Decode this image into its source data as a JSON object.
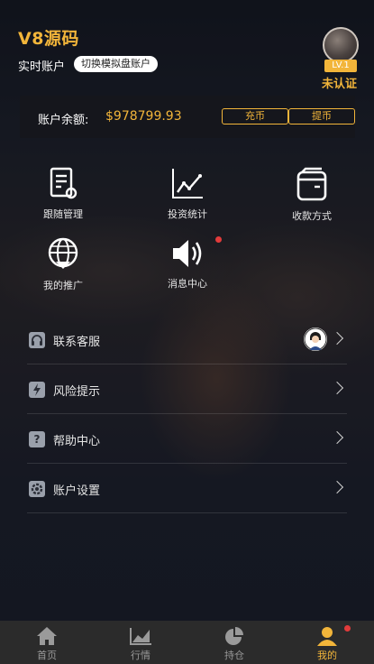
{
  "header": {
    "brand": "V8源码",
    "account_type": "实时账户",
    "switch_label": "切换模拟盘账户",
    "level": "LV.1",
    "verify_status": "未认证"
  },
  "balance": {
    "label": "账户余额:",
    "value": "$978799.93",
    "deposit_label": "充币",
    "withdraw_label": "提币"
  },
  "grid": [
    {
      "label": "跟随管理",
      "icon": "follow-manage-icon"
    },
    {
      "label": "投资统计",
      "icon": "invest-stats-icon"
    },
    {
      "label": "收款方式",
      "icon": "wallet-icon"
    },
    {
      "label": "我的推广",
      "icon": "globe-promo-icon"
    },
    {
      "label": "消息中心",
      "icon": "speaker-icon"
    }
  ],
  "list": [
    {
      "label": "联系客服",
      "icon": "headset-icon"
    },
    {
      "label": "风险提示",
      "icon": "lightning-icon"
    },
    {
      "label": "帮助中心",
      "icon": "question-icon"
    },
    {
      "label": "账户设置",
      "icon": "settings-icon"
    }
  ],
  "tabs": [
    {
      "label": "首页",
      "icon": "home-icon"
    },
    {
      "label": "行情",
      "icon": "market-chart-icon"
    },
    {
      "label": "持仓",
      "icon": "pie-chart-icon"
    },
    {
      "label": "我的",
      "icon": "user-icon"
    }
  ],
  "colors": {
    "accent": "#f2b53a",
    "notification": "#e23b3b",
    "tabbar": "#2b2b2b"
  }
}
